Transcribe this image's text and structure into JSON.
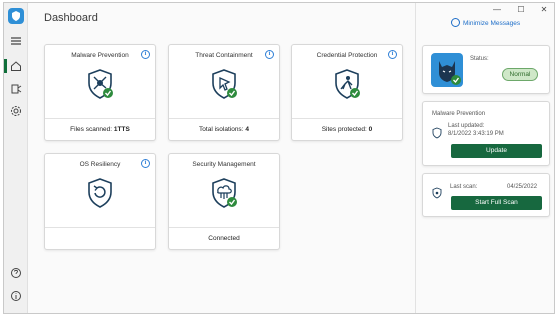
{
  "page": {
    "title": "Dashboard"
  },
  "window_controls": {
    "minimize": "—",
    "maximize": "☐",
    "close": "✕"
  },
  "minimize_messages": "Minimize Messages",
  "cards": [
    {
      "title": "Malware Prevention",
      "footer_label": "Files scanned:",
      "footer_value": "1TTS",
      "icon": "malware-shield-icon"
    },
    {
      "title": "Threat Containment",
      "footer_label": "Total isolations:",
      "footer_value": "4",
      "icon": "threat-containment-icon"
    },
    {
      "title": "Credential Protection",
      "footer_label": "Sites protected:",
      "footer_value": "0",
      "icon": "credential-protection-icon"
    },
    {
      "title": "OS Resiliency",
      "footer_label": "",
      "footer_value": "",
      "icon": "os-resiliency-icon"
    },
    {
      "title": "Security Management",
      "footer_label": "Connected",
      "footer_value": "",
      "icon": "security-management-icon"
    }
  ],
  "status": {
    "label": "Status:",
    "value": "Normal"
  },
  "malware_panel": {
    "title": "Malware Prevention",
    "updated_label": "Last updated:",
    "updated_value": "8/1/2022 3:43:19 PM",
    "button": "Update"
  },
  "scan_panel": {
    "label": "Last scan:",
    "date": "04/25/2022",
    "button": "Start Full Scan"
  },
  "colors": {
    "accent_green": "#17683f",
    "accent_blue": "#2f7fd6",
    "icon_navy": "#1d3f5c",
    "check_green": "#2e8b3d"
  }
}
